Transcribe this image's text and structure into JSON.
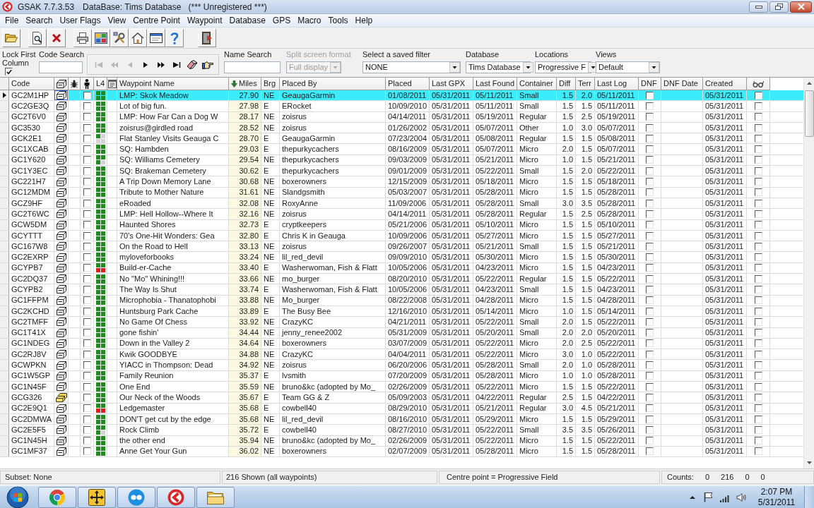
{
  "window": {
    "title": "GSAK 7.7.3.53",
    "database": "DataBase: Tims Database",
    "registration": "(*** Unregistered ***)"
  },
  "menu": [
    "File",
    "Search",
    "User Flags",
    "View",
    "Centre Point",
    "Waypoint",
    "Database",
    "GPS",
    "Macro",
    "Tools",
    "Help"
  ],
  "filters": {
    "lock_first_column": {
      "label": "Lock First Column",
      "checked": true
    },
    "code_search": {
      "label": "Code Search"
    },
    "navigation": [
      {
        "kind": "first",
        "disabled": true
      },
      {
        "kind": "previous_page",
        "disabled": true
      },
      {
        "kind": "previous",
        "disabled": true
      },
      {
        "kind": "next",
        "disabled": false
      },
      {
        "kind": "next_page",
        "disabled": false
      },
      {
        "kind": "last",
        "disabled": false
      },
      {
        "kind": "clear",
        "disabled": false
      },
      {
        "kind": "go_to",
        "disabled": false
      }
    ],
    "name_search": {
      "label": "Name Search"
    },
    "split_screen": {
      "label": "Split screen format",
      "value": "Full display",
      "disabled": true
    },
    "saved_filter": {
      "label": "Select a saved filter",
      "value": "NONE"
    },
    "database": {
      "label": "Database",
      "value": "Tims Database"
    },
    "locations": {
      "label": "Locations",
      "value": "Progressive F"
    },
    "views": {
      "label": "Views",
      "value": "Default"
    }
  },
  "table": {
    "columns": [
      {
        "kind": "text",
        "label": "Code",
        "sorted": false
      },
      {
        "kind": "icon",
        "sorted": false
      },
      {
        "kind": "icon",
        "sorted": false
      },
      {
        "kind": "icon",
        "sorted": false
      },
      {
        "kind": "text",
        "label": "L4",
        "sorted": false
      },
      {
        "kind": "icon",
        "sorted": false
      },
      {
        "kind": "text",
        "label": "Waypoint Name",
        "sorted": false
      },
      {
        "kind": "text",
        "label": "Miles",
        "sorted": true
      },
      {
        "kind": "text",
        "label": "Brg",
        "sorted": false
      },
      {
        "kind": "text",
        "label": "Placed By",
        "sorted": false
      },
      {
        "kind": "text",
        "label": "Placed",
        "sorted": false
      },
      {
        "kind": "text",
        "label": "Last GPX",
        "sorted": false
      },
      {
        "kind": "text",
        "label": "Last Found",
        "sorted": false
      },
      {
        "kind": "text",
        "label": "Container",
        "sorted": false
      },
      {
        "kind": "text",
        "label": "Diff",
        "sorted": false
      },
      {
        "kind": "text",
        "label": "Terr",
        "sorted": false
      },
      {
        "kind": "text",
        "label": "Last Log",
        "sorted": false
      },
      {
        "kind": "text",
        "label": "DNF",
        "sorted": false
      },
      {
        "kind": "text",
        "label": "DNF Date",
        "sorted": false
      },
      {
        "kind": "text",
        "label": "Created",
        "sorted": false
      },
      {
        "kind": "icon",
        "sorted": false
      }
    ],
    "rows": [
      {
        "selected": true,
        "code": "GC2M1HP",
        "kind": "traditional",
        "person_column_checked": false,
        "l4": [
          {
            "color": "#1e8c1e"
          },
          {
            "color": "#1e8c1e"
          },
          {
            "color": "#1e8c1e"
          },
          {
            "color": "#1e8c1e"
          }
        ],
        "name": "LMP: Skok Meadow",
        "miles": "27.90",
        "brg": "NE",
        "placed_by": "GeaugaGarmin",
        "placed": "01/08/2011",
        "last_gpx": "05/31/2011",
        "last_found": "05/11/2011",
        "container": "Small",
        "diff": "1.5",
        "terr": "2.0",
        "last_log": "05/11/2011",
        "dnf_checked": false,
        "created": "05/31/2011",
        "glasses_column_checked": false
      },
      {
        "selected": false,
        "code": "GC2GE3Q",
        "kind": "traditional",
        "person_column_checked": false,
        "l4": [
          {
            "color": "#1e8c1e"
          },
          {
            "color": "#1e8c1e"
          },
          {
            "color": "#1e8c1e"
          },
          {
            "color": "#1e8c1e"
          }
        ],
        "name": "Lot of big fun.",
        "miles": "27.98",
        "brg": "E",
        "placed_by": "ERocket",
        "placed": "10/09/2010",
        "last_gpx": "05/31/2011",
        "last_found": "05/11/2011",
        "container": "Small",
        "diff": "1.5",
        "terr": "1.5",
        "last_log": "05/11/2011",
        "dnf_checked": false,
        "created": "05/31/2011",
        "glasses_column_checked": false
      },
      {
        "selected": false,
        "code": "GC2T6V0",
        "kind": "traditional",
        "person_column_checked": false,
        "l4": [
          {
            "color": "#1e8c1e"
          },
          {
            "color": "#1e8c1e"
          },
          {
            "color": "#1e8c1e"
          },
          {
            "color": "#1e8c1e"
          }
        ],
        "name": "LMP: How Far Can a Dog W",
        "miles": "28.17",
        "brg": "NE",
        "placed_by": "zoisrus",
        "placed": "04/14/2011",
        "last_gpx": "05/31/2011",
        "last_found": "05/19/2011",
        "container": "Regular",
        "diff": "1.5",
        "terr": "2.5",
        "last_log": "05/19/2011",
        "dnf_checked": false,
        "created": "05/31/2011",
        "glasses_column_checked": false
      },
      {
        "selected": false,
        "code": "GC3530",
        "kind": "traditional",
        "person_column_checked": false,
        "l4": [
          {
            "color": "#1e8c1e"
          },
          {
            "color": "#1e8c1e"
          },
          {
            "color": "#1e8c1e"
          },
          {
            "color": "#1e8c1e"
          }
        ],
        "name": "zoisrus@girdled road",
        "miles": "28.52",
        "brg": "NE",
        "placed_by": "zoisrus",
        "placed": "01/26/2002",
        "last_gpx": "05/31/2011",
        "last_found": "05/07/2011",
        "container": "Other",
        "diff": "1.0",
        "terr": "3.0",
        "last_log": "05/07/2011",
        "dnf_checked": false,
        "created": "05/31/2011",
        "glasses_column_checked": false
      },
      {
        "selected": false,
        "code": "GCK2E1",
        "kind": "traditional",
        "person_column_checked": false,
        "l4": [
          {
            "color": "#1e8c1e"
          },
          {
            "color": "#d4d4d4"
          },
          {
            "color": "#d4d4d4"
          },
          {
            "color": "#d4d4d4"
          }
        ],
        "name": "Flat Stanley Visits Geauga C",
        "miles": "28.70",
        "brg": "E",
        "placed_by": "GeaugaGarmin",
        "placed": "07/23/2004",
        "last_gpx": "05/31/2011",
        "last_found": "05/08/2011",
        "container": "Regular",
        "diff": "1.5",
        "terr": "1.5",
        "last_log": "05/08/2011",
        "dnf_checked": false,
        "created": "05/31/2011",
        "glasses_column_checked": false
      },
      {
        "selected": false,
        "code": "GC1XCAB",
        "kind": "traditional",
        "person_column_checked": false,
        "l4": [
          {
            "color": "#1e8c1e"
          },
          {
            "color": "#1e8c1e"
          },
          {
            "color": "#1e8c1e"
          },
          {
            "color": "#1e8c1e"
          }
        ],
        "name": "SQ: Hambden",
        "miles": "29.03",
        "brg": "E",
        "placed_by": "thepurkycachers",
        "placed": "08/16/2009",
        "last_gpx": "05/31/2011",
        "last_found": "05/07/2011",
        "container": "Micro",
        "diff": "2.0",
        "terr": "1.5",
        "last_log": "05/07/2011",
        "dnf_checked": false,
        "created": "05/31/2011",
        "glasses_column_checked": false
      },
      {
        "selected": false,
        "code": "GC1Y620",
        "kind": "traditional",
        "person_column_checked": false,
        "l4": [
          {
            "color": "#1e8c1e"
          },
          {
            "color": "#1e8c1e"
          },
          {
            "color": "#1e8c1e"
          },
          {
            "color": "#d4d4d4"
          }
        ],
        "name": "SQ: Williams Cemetery",
        "miles": "29.54",
        "brg": "NE",
        "placed_by": "thepurkycachers",
        "placed": "09/03/2009",
        "last_gpx": "05/31/2011",
        "last_found": "05/21/2011",
        "container": "Micro",
        "diff": "1.0",
        "terr": "1.5",
        "last_log": "05/21/2011",
        "dnf_checked": false,
        "created": "05/31/2011",
        "glasses_column_checked": false
      },
      {
        "selected": false,
        "code": "GC1Y3EC",
        "kind": "traditional",
        "person_column_checked": false,
        "l4": [
          {
            "color": "#1e8c1e"
          },
          {
            "color": "#1e8c1e"
          },
          {
            "color": "#1e8c1e"
          },
          {
            "color": "#1e8c1e"
          }
        ],
        "name": "SQ: Brakeman Cemetery",
        "miles": "30.62",
        "brg": "E",
        "placed_by": "thepurkycachers",
        "placed": "09/01/2009",
        "last_gpx": "05/31/2011",
        "last_found": "05/22/2011",
        "container": "Small",
        "diff": "1.5",
        "terr": "2.0",
        "last_log": "05/22/2011",
        "dnf_checked": false,
        "created": "05/31/2011",
        "glasses_column_checked": false
      },
      {
        "selected": false,
        "code": "GC221H7",
        "kind": "traditional",
        "person_column_checked": false,
        "l4": [
          {
            "color": "#1e8c1e"
          },
          {
            "color": "#1e8c1e"
          },
          {
            "color": "#1e8c1e"
          },
          {
            "color": "#1e8c1e"
          }
        ],
        "name": "A Trip Down Memory Lane",
        "miles": "30.68",
        "brg": "NE",
        "placed_by": "boxerowners",
        "placed": "12/15/2009",
        "last_gpx": "05/31/2011",
        "last_found": "05/18/2011",
        "container": "Micro",
        "diff": "1.5",
        "terr": "1.5",
        "last_log": "05/18/2011",
        "dnf_checked": false,
        "created": "05/31/2011",
        "glasses_column_checked": false
      },
      {
        "selected": false,
        "code": "GC12MDM",
        "kind": "traditional",
        "person_column_checked": false,
        "l4": [
          {
            "color": "#1e8c1e"
          },
          {
            "color": "#1e8c1e"
          },
          {
            "color": "#1e8c1e"
          },
          {
            "color": "#1e8c1e"
          }
        ],
        "name": "Tribute to Mother Nature",
        "miles": "31.61",
        "brg": "NE",
        "placed_by": "Slandgsmith",
        "placed": "05/03/2007",
        "last_gpx": "05/31/2011",
        "last_found": "05/28/2011",
        "container": "Micro",
        "diff": "1.5",
        "terr": "1.5",
        "last_log": "05/28/2011",
        "dnf_checked": false,
        "created": "05/31/2011",
        "glasses_column_checked": false
      },
      {
        "selected": false,
        "code": "GCZ9HF",
        "kind": "traditional",
        "person_column_checked": false,
        "l4": [
          {
            "color": "#1e8c1e"
          },
          {
            "color": "#1e8c1e"
          },
          {
            "color": "#1e8c1e"
          },
          {
            "color": "#1e8c1e"
          }
        ],
        "name": "eRoaded",
        "miles": "32.08",
        "brg": "NE",
        "placed_by": "RoxyAnne",
        "placed": "11/09/2006",
        "last_gpx": "05/31/2011",
        "last_found": "05/28/2011",
        "container": "Small",
        "diff": "3.0",
        "terr": "3.5",
        "last_log": "05/28/2011",
        "dnf_checked": false,
        "created": "05/31/2011",
        "glasses_column_checked": false
      },
      {
        "selected": false,
        "code": "GC2T6WC",
        "kind": "traditional",
        "person_column_checked": false,
        "l4": [
          {
            "color": "#1e8c1e"
          },
          {
            "color": "#1e8c1e"
          },
          {
            "color": "#1e8c1e"
          },
          {
            "color": "#1e8c1e"
          }
        ],
        "name": "LMP: Hell Hollow--Where It",
        "miles": "32.16",
        "brg": "NE",
        "placed_by": "zoisrus",
        "placed": "04/14/2011",
        "last_gpx": "05/31/2011",
        "last_found": "05/28/2011",
        "container": "Regular",
        "diff": "1.5",
        "terr": "2.5",
        "last_log": "05/28/2011",
        "dnf_checked": false,
        "created": "05/31/2011",
        "glasses_column_checked": false
      },
      {
        "selected": false,
        "code": "GCW5DM",
        "kind": "traditional",
        "person_column_checked": false,
        "l4": [
          {
            "color": "#1e8c1e"
          },
          {
            "color": "#1e8c1e"
          },
          {
            "color": "#1e8c1e"
          },
          {
            "color": "#1e8c1e"
          }
        ],
        "name": "Haunted Shores",
        "miles": "32.73",
        "brg": "E",
        "placed_by": "cryptkeepers",
        "placed": "05/21/2006",
        "last_gpx": "05/31/2011",
        "last_found": "05/10/2011",
        "container": "Micro",
        "diff": "1.5",
        "terr": "1.5",
        "last_log": "05/10/2011",
        "dnf_checked": false,
        "created": "05/31/2011",
        "glasses_column_checked": false
      },
      {
        "selected": false,
        "code": "GCYTTT",
        "kind": "traditional",
        "person_column_checked": false,
        "l4": [
          {
            "color": "#1e8c1e"
          },
          {
            "color": "#1e8c1e"
          },
          {
            "color": "#1e8c1e"
          },
          {
            "color": "#1e8c1e"
          }
        ],
        "name": "70's One-Hit Wonders: Gea",
        "miles": "32.80",
        "brg": "E",
        "placed_by": "Chris K in Geauga",
        "placed": "10/09/2006",
        "last_gpx": "05/31/2011",
        "last_found": "05/27/2011",
        "container": "Micro",
        "diff": "1.5",
        "terr": "1.5",
        "last_log": "05/27/2011",
        "dnf_checked": false,
        "created": "05/31/2011",
        "glasses_column_checked": false
      },
      {
        "selected": false,
        "code": "GC167W8",
        "kind": "traditional",
        "person_column_checked": false,
        "l4": [
          {
            "color": "#1e8c1e"
          },
          {
            "color": "#1e8c1e"
          },
          {
            "color": "#1e8c1e"
          },
          {
            "color": "#1e8c1e"
          }
        ],
        "name": "On the Road to Hell",
        "miles": "33.13",
        "brg": "NE",
        "placed_by": "zoisrus",
        "placed": "09/26/2007",
        "last_gpx": "05/31/2011",
        "last_found": "05/21/2011",
        "container": "Small",
        "diff": "1.5",
        "terr": "1.5",
        "last_log": "05/21/2011",
        "dnf_checked": false,
        "created": "05/31/2011",
        "glasses_column_checked": false
      },
      {
        "selected": false,
        "code": "GC2EXRP",
        "kind": "traditional",
        "person_column_checked": false,
        "l4": [
          {
            "color": "#1e8c1e"
          },
          {
            "color": "#1e8c1e"
          },
          {
            "color": "#1e8c1e"
          },
          {
            "color": "#1e8c1e"
          }
        ],
        "name": "myloveforbooks",
        "miles": "33.24",
        "brg": "NE",
        "placed_by": "lil_red_devil",
        "placed": "09/09/2010",
        "last_gpx": "05/31/2011",
        "last_found": "05/30/2011",
        "container": "Micro",
        "diff": "1.5",
        "terr": "1.5",
        "last_log": "05/30/2011",
        "dnf_checked": false,
        "created": "05/31/2011",
        "glasses_column_checked": false
      },
      {
        "selected": false,
        "code": "GCYPB7",
        "kind": "traditional",
        "person_column_checked": false,
        "l4": [
          {
            "color": "#1e8c1e"
          },
          {
            "color": "#1e8c1e"
          },
          {
            "color": "#e0201c"
          },
          {
            "color": "#e0201c"
          }
        ],
        "name": "Build-er-Cache",
        "miles": "33.40",
        "brg": "E",
        "placed_by": "Washerwoman, Fish & Flatt",
        "placed": "10/05/2006",
        "last_gpx": "05/31/2011",
        "last_found": "04/23/2011",
        "container": "Micro",
        "diff": "1.5",
        "terr": "1.5",
        "last_log": "04/23/2011",
        "dnf_checked": false,
        "created": "05/31/2011",
        "glasses_column_checked": false
      },
      {
        "selected": false,
        "code": "GC2DQ37",
        "kind": "traditional",
        "person_column_checked": false,
        "l4": [
          {
            "color": "#1e8c1e"
          },
          {
            "color": "#1e8c1e"
          },
          {
            "color": "#1e8c1e"
          },
          {
            "color": "#1e8c1e"
          }
        ],
        "name": "No \"Mo\" Whining!!!",
        "miles": "33.66",
        "brg": "NE",
        "placed_by": "mo_burger",
        "placed": "08/20/2010",
        "last_gpx": "05/31/2011",
        "last_found": "05/22/2011",
        "container": "Regular",
        "diff": "1.5",
        "terr": "1.5",
        "last_log": "05/22/2011",
        "dnf_checked": false,
        "created": "05/31/2011",
        "glasses_column_checked": false
      },
      {
        "selected": false,
        "code": "GCYPB2",
        "kind": "traditional",
        "person_column_checked": false,
        "l4": [
          {
            "color": "#1e8c1e"
          },
          {
            "color": "#1e8c1e"
          },
          {
            "color": "#1e8c1e"
          },
          {
            "color": "#1e8c1e"
          }
        ],
        "name": "The Way Is Shut",
        "miles": "33.74",
        "brg": "E",
        "placed_by": "Washerwoman, Fish & Flatt",
        "placed": "10/05/2006",
        "last_gpx": "05/31/2011",
        "last_found": "04/23/2011",
        "container": "Small",
        "diff": "1.5",
        "terr": "1.5",
        "last_log": "04/23/2011",
        "dnf_checked": false,
        "created": "05/31/2011",
        "glasses_column_checked": false
      },
      {
        "selected": false,
        "code": "GC1FFPM",
        "kind": "traditional",
        "person_column_checked": false,
        "l4": [
          {
            "color": "#1e8c1e"
          },
          {
            "color": "#1e8c1e"
          },
          {
            "color": "#1e8c1e"
          },
          {
            "color": "#1e8c1e"
          }
        ],
        "name": "Microphobia - Thanatophobi",
        "miles": "33.88",
        "brg": "NE",
        "placed_by": "Mo_burger",
        "placed": "08/22/2008",
        "last_gpx": "05/31/2011",
        "last_found": "04/28/2011",
        "container": "Micro",
        "diff": "1.5",
        "terr": "1.5",
        "last_log": "04/28/2011",
        "dnf_checked": false,
        "created": "05/31/2011",
        "glasses_column_checked": false
      },
      {
        "selected": false,
        "code": "GC2KCHD",
        "kind": "traditional",
        "person_column_checked": false,
        "l4": [
          {
            "color": "#1e8c1e"
          },
          {
            "color": "#1e8c1e"
          },
          {
            "color": "#1e8c1e"
          },
          {
            "color": "#1e8c1e"
          }
        ],
        "name": "Huntsburg Park Cache",
        "miles": "33.89",
        "brg": "E",
        "placed_by": "The Busy Bee",
        "placed": "12/16/2010",
        "last_gpx": "05/31/2011",
        "last_found": "05/14/2011",
        "container": "Micro",
        "diff": "1.0",
        "terr": "1.5",
        "last_log": "05/14/2011",
        "dnf_checked": false,
        "created": "05/31/2011",
        "glasses_column_checked": false
      },
      {
        "selected": false,
        "code": "GC2TMFF",
        "kind": "traditional",
        "person_column_checked": false,
        "l4": [
          {
            "color": "#1e8c1e"
          },
          {
            "color": "#1e8c1e"
          },
          {
            "color": "#1e8c1e"
          },
          {
            "color": "#1e8c1e"
          }
        ],
        "name": "No Game Of Chess",
        "miles": "33.92",
        "brg": "NE",
        "placed_by": "CrazyKC",
        "placed": "04/21/2011",
        "last_gpx": "05/31/2011",
        "last_found": "05/22/2011",
        "container": "Small",
        "diff": "2.0",
        "terr": "1.5",
        "last_log": "05/22/2011",
        "dnf_checked": false,
        "created": "05/31/2011",
        "glasses_column_checked": false
      },
      {
        "selected": false,
        "code": "GC1T41X",
        "kind": "traditional",
        "person_column_checked": false,
        "l4": [
          {
            "color": "#1e8c1e"
          },
          {
            "color": "#1e8c1e"
          },
          {
            "color": "#1e8c1e"
          },
          {
            "color": "#1e8c1e"
          }
        ],
        "name": "gone fishin'",
        "miles": "34.44",
        "brg": "NE",
        "placed_by": "jenny_renee2002",
        "placed": "05/31/2009",
        "last_gpx": "05/31/2011",
        "last_found": "05/20/2011",
        "container": "Small",
        "diff": "2.0",
        "terr": "2.0",
        "last_log": "05/20/2011",
        "dnf_checked": false,
        "created": "05/31/2011",
        "glasses_column_checked": false
      },
      {
        "selected": false,
        "code": "GC1NDEG",
        "kind": "traditional",
        "person_column_checked": false,
        "l4": [
          {
            "color": "#1e8c1e"
          },
          {
            "color": "#1e8c1e"
          },
          {
            "color": "#1e8c1e"
          },
          {
            "color": "#1e8c1e"
          }
        ],
        "name": "Down in the Valley 2",
        "miles": "34.64",
        "brg": "NE",
        "placed_by": "boxerowners",
        "placed": "03/07/2009",
        "last_gpx": "05/31/2011",
        "last_found": "05/22/2011",
        "container": "Micro",
        "diff": "2.0",
        "terr": "2.5",
        "last_log": "05/22/2011",
        "dnf_checked": false,
        "created": "05/31/2011",
        "glasses_column_checked": false
      },
      {
        "selected": false,
        "code": "GC2RJ8V",
        "kind": "traditional",
        "person_column_checked": false,
        "l4": [
          {
            "color": "#1e8c1e"
          },
          {
            "color": "#1e8c1e"
          },
          {
            "color": "#1e8c1e"
          },
          {
            "color": "#1e8c1e"
          }
        ],
        "name": "Kwik GOODBYE",
        "miles": "34.88",
        "brg": "NE",
        "placed_by": "CrazyKC",
        "placed": "04/04/2011",
        "last_gpx": "05/31/2011",
        "last_found": "05/22/2011",
        "container": "Micro",
        "diff": "3.0",
        "terr": "1.0",
        "last_log": "05/22/2011",
        "dnf_checked": false,
        "created": "05/31/2011",
        "glasses_column_checked": false
      },
      {
        "selected": false,
        "code": "GCWPKN",
        "kind": "traditional",
        "person_column_checked": false,
        "l4": [
          {
            "color": "#1e8c1e"
          },
          {
            "color": "#1e8c1e"
          },
          {
            "color": "#1e8c1e"
          },
          {
            "color": "#1e8c1e"
          }
        ],
        "name": "YIACC in Thompson: Dead",
        "miles": "34.92",
        "brg": "NE",
        "placed_by": "zoisrus",
        "placed": "06/20/2006",
        "last_gpx": "05/31/2011",
        "last_found": "05/28/2011",
        "container": "Small",
        "diff": "2.0",
        "terr": "1.0",
        "last_log": "05/28/2011",
        "dnf_checked": false,
        "created": "05/31/2011",
        "glasses_column_checked": false
      },
      {
        "selected": false,
        "code": "GC1W5GP",
        "kind": "traditional",
        "person_column_checked": false,
        "l4": [
          {
            "color": "#1e8c1e"
          },
          {
            "color": "#1e8c1e"
          },
          {
            "color": "#1e8c1e"
          },
          {
            "color": "#1e8c1e"
          }
        ],
        "name": "Family Reunion",
        "miles": "35.37",
        "brg": "E",
        "placed_by": "lvsmith",
        "placed": "07/20/2009",
        "last_gpx": "05/31/2011",
        "last_found": "05/28/2011",
        "container": "Micro",
        "diff": "1.0",
        "terr": "1.0",
        "last_log": "05/28/2011",
        "dnf_checked": false,
        "created": "05/31/2011",
        "glasses_column_checked": false
      },
      {
        "selected": false,
        "code": "GC1N45F",
        "kind": "traditional",
        "person_column_checked": false,
        "l4": [
          {
            "color": "#1e8c1e"
          },
          {
            "color": "#1e8c1e"
          },
          {
            "color": "#1e8c1e"
          },
          {
            "color": "#1e8c1e"
          }
        ],
        "name": "One End",
        "miles": "35.59",
        "brg": "NE",
        "placed_by": "bruno&kc (adopted by Mo_",
        "placed": "02/26/2009",
        "last_gpx": "05/31/2011",
        "last_found": "05/22/2011",
        "container": "Micro",
        "diff": "1.5",
        "terr": "1.5",
        "last_log": "05/22/2011",
        "dnf_checked": false,
        "created": "05/31/2011",
        "glasses_column_checked": false
      },
      {
        "selected": false,
        "code": "GCG326",
        "kind": "multi",
        "person_column_checked": false,
        "l4": [
          {
            "color": "#1e8c1e"
          },
          {
            "color": "#1e8c1e"
          },
          {
            "color": "#1e8c1e"
          },
          {
            "color": "#1e8c1e"
          }
        ],
        "name": "Our Neck of the Woods",
        "miles": "35.67",
        "brg": "E",
        "placed_by": "Team GG & Z",
        "placed": "05/09/2003",
        "last_gpx": "05/31/2011",
        "last_found": "04/22/2011",
        "container": "Regular",
        "diff": "2.5",
        "terr": "1.5",
        "last_log": "04/22/2011",
        "dnf_checked": false,
        "created": "05/31/2011",
        "glasses_column_checked": false
      },
      {
        "selected": false,
        "code": "GC2E9Q1",
        "kind": "traditional",
        "person_column_checked": false,
        "l4": [
          {
            "color": "#1e8c1e"
          },
          {
            "color": "#1e8c1e"
          },
          {
            "color": "#e0201c"
          },
          {
            "color": "#e0201c"
          }
        ],
        "name": "Ledgemaster",
        "miles": "35.68",
        "brg": "E",
        "placed_by": "cowbell40",
        "placed": "08/29/2010",
        "last_gpx": "05/31/2011",
        "last_found": "05/21/2011",
        "container": "Regular",
        "diff": "3.0",
        "terr": "4.5",
        "last_log": "05/21/2011",
        "dnf_checked": false,
        "created": "05/31/2011",
        "glasses_column_checked": false
      },
      {
        "selected": false,
        "code": "GC2DMWA",
        "kind": "traditional",
        "person_column_checked": false,
        "l4": [
          {
            "color": "#1e8c1e"
          },
          {
            "color": "#1e8c1e"
          },
          {
            "color": "#1e8c1e"
          },
          {
            "color": "#1e8c1e"
          }
        ],
        "name": "DON'T get cut by the edge",
        "miles": "35.68",
        "brg": "NE",
        "placed_by": "lil_red_devil",
        "placed": "08/16/2010",
        "last_gpx": "05/31/2011",
        "last_found": "05/29/2011",
        "container": "Micro",
        "diff": "1.5",
        "terr": "1.5",
        "last_log": "05/29/2011",
        "dnf_checked": false,
        "created": "05/31/2011",
        "glasses_column_checked": false
      },
      {
        "selected": false,
        "code": "GC2E5F5",
        "kind": "traditional",
        "person_column_checked": false,
        "l4": [
          {
            "color": "#1e8c1e"
          },
          {
            "color": "#1e8c1e"
          },
          {
            "color": "#1e8c1e"
          },
          {
            "color": "#d4d4d4"
          }
        ],
        "name": "Rock Climb",
        "miles": "35.72",
        "brg": "E",
        "placed_by": "cowbell40",
        "placed": "08/27/2010",
        "last_gpx": "05/31/2011",
        "last_found": "05/22/2011",
        "container": "Small",
        "diff": "3.5",
        "terr": "3.5",
        "last_log": "05/26/2011",
        "dnf_checked": false,
        "created": "05/31/2011",
        "glasses_column_checked": false
      },
      {
        "selected": false,
        "code": "GC1N45H",
        "kind": "traditional",
        "person_column_checked": false,
        "l4": [
          {
            "color": "#1e8c1e"
          },
          {
            "color": "#1e8c1e"
          },
          {
            "color": "#1e8c1e"
          },
          {
            "color": "#1e8c1e"
          }
        ],
        "name": "the other end",
        "miles": "35.94",
        "brg": "NE",
        "placed_by": "bruno&kc (adopted by Mo_",
        "placed": "02/26/2009",
        "last_gpx": "05/31/2011",
        "last_found": "05/22/2011",
        "container": "Micro",
        "diff": "1.5",
        "terr": "1.5",
        "last_log": "05/22/2011",
        "dnf_checked": false,
        "created": "05/31/2011",
        "glasses_column_checked": false
      },
      {
        "selected": false,
        "code": "GC1MF37",
        "kind": "traditional",
        "person_column_checked": false,
        "l4": [
          {
            "color": "#1e8c1e"
          },
          {
            "color": "#1e8c1e"
          },
          {
            "color": "#1e8c1e"
          },
          {
            "color": "#1e8c1e"
          }
        ],
        "name": "Anne Get Your Gun",
        "miles": "36.02",
        "brg": "NE",
        "placed_by": "boxerowners",
        "placed": "02/07/2009",
        "last_gpx": "05/31/2011",
        "last_found": "05/28/2011",
        "container": "Micro",
        "diff": "1.5",
        "terr": "1.5",
        "last_log": "05/28/2011",
        "dnf_checked": false,
        "created": "05/31/2011",
        "glasses_column_checked": false
      }
    ]
  },
  "status_bar": {
    "subset": "Subset: None",
    "shown": "216 Shown (all waypoints)",
    "centre_point": "Centre point = Progressive Field",
    "counts_label": "Counts:",
    "counts": [
      "0",
      "216",
      "0",
      "0"
    ]
  },
  "taskbar": {
    "time": "2:07 PM",
    "date": "5/31/2011"
  }
}
